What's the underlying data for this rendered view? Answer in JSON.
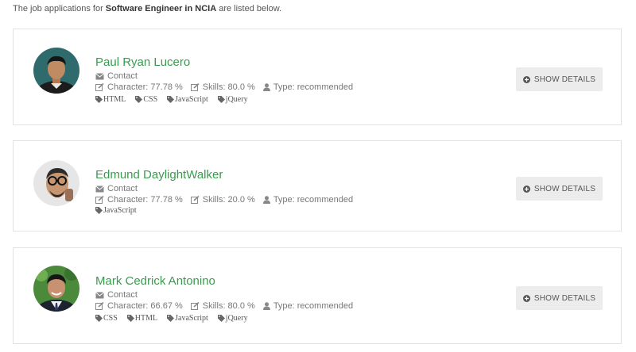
{
  "intro": {
    "prefix": "The job applications for ",
    "position": "Software Engineer in NCIA",
    "suffix": " are listed below."
  },
  "labels": {
    "contact": "Contact",
    "show_details": "SHOW DETAILS"
  },
  "applicants": [
    {
      "name": "Paul Ryan Lucero",
      "character": "Character: 77.78 %",
      "skills": "Skills: 80.0 %",
      "type": "Type: recommended",
      "tags": [
        "HTML",
        "CSS",
        "JavaScript",
        "jQuery"
      ]
    },
    {
      "name": "Edmund DaylightWalker",
      "character": "Character: 77.78 %",
      "skills": "Skills: 20.0 %",
      "type": "Type: recommended",
      "tags": [
        "JavaScript"
      ]
    },
    {
      "name": "Mark Cedrick Antonino",
      "character": "Character: 66.67 %",
      "skills": "Skills: 80.0 %",
      "type": "Type: recommended",
      "tags": [
        "CSS",
        "HTML",
        "JavaScript",
        "jQuery"
      ]
    }
  ],
  "icons": {
    "contact": "envelope-icon",
    "character": "edit-icon",
    "skills": "edit-icon",
    "type": "user-icon",
    "tag": "tag-icon",
    "show_details": "plus-circle-icon"
  },
  "colors": {
    "name": "#3a9b4f",
    "button_bg": "#ececec",
    "card_border": "#e2e2e2"
  }
}
